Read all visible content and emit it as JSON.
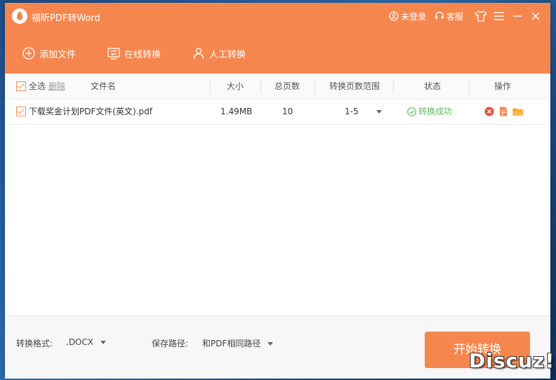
{
  "app": {
    "title": "福昕PDF转Word"
  },
  "topbar": {
    "login_label": "未登录",
    "service_label": "客服"
  },
  "toolbar": {
    "add_file": "添加文件",
    "online_convert": "在线转换",
    "manual_convert": "人工转换"
  },
  "table": {
    "select_all": "全选",
    "delete": "删除",
    "columns": {
      "filename": "文件名",
      "size": "大小",
      "pages": "总页数",
      "range": "转换页数范围",
      "status": "状态",
      "actions": "操作"
    },
    "rows": [
      {
        "checked": true,
        "filename": "下载奖金计划PDF文件(英文).pdf",
        "size": "1.49MB",
        "pages": "10",
        "range": "1-5",
        "status": "转换成功"
      }
    ]
  },
  "bottom": {
    "format_label": "转换格式:",
    "format_value": ".DOCX",
    "path_label": "保存路径:",
    "path_value": "和PDF相同路径",
    "start_button": "开始转换"
  },
  "watermark": "Discuz!",
  "colors": {
    "accent": "#f5874e",
    "success": "#5cb85c",
    "danger": "#e84c3d",
    "folder": "#f5a623"
  }
}
